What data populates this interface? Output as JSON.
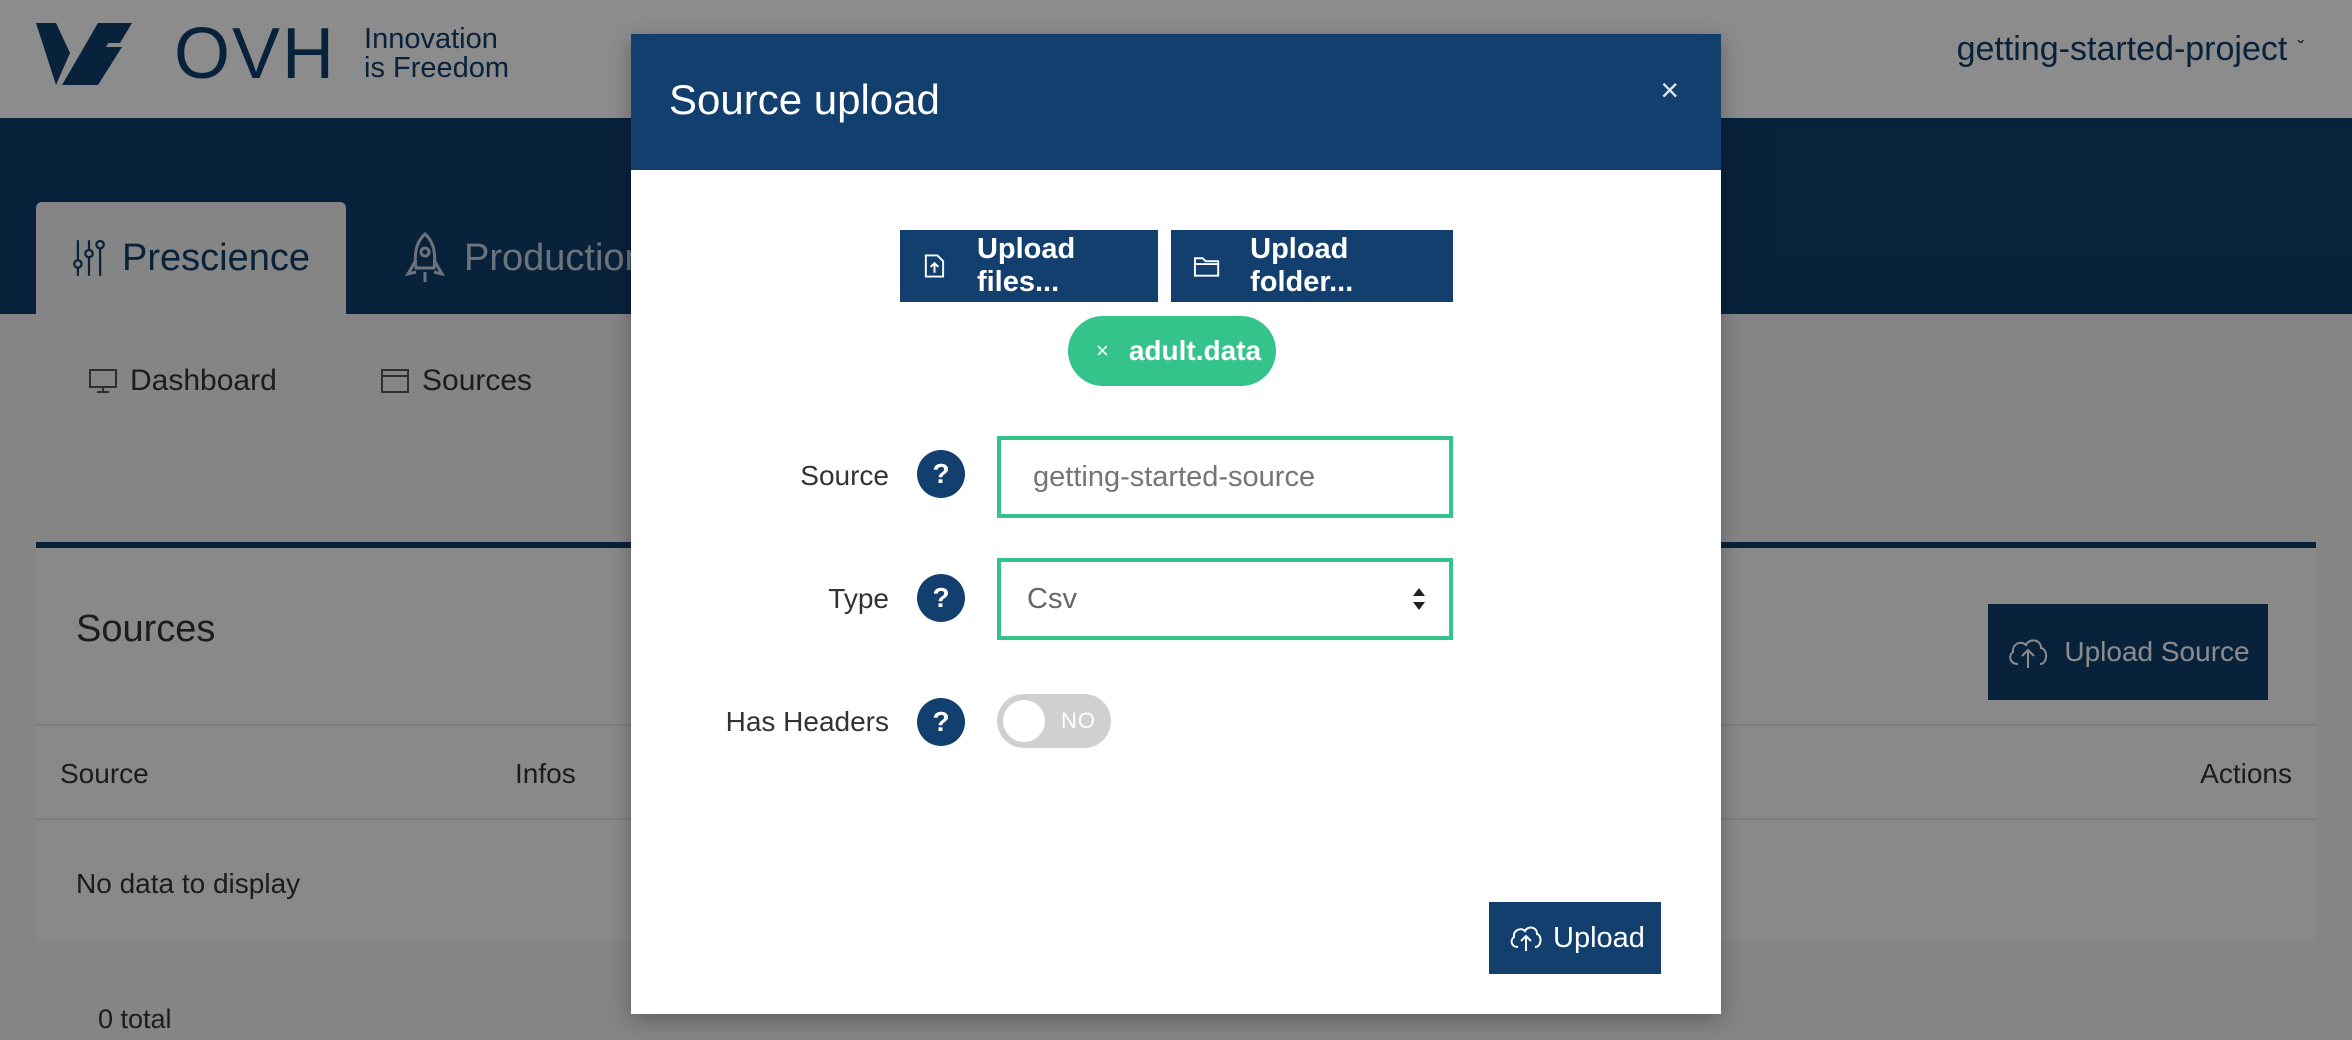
{
  "logo": {
    "brand": "OVH",
    "tagline_line1": "Innovation",
    "tagline_line2": "is Freedom"
  },
  "project_selector": {
    "label": "getting-started-project",
    "chevron": "ˇ"
  },
  "main_tabs": [
    {
      "label": "Prescience",
      "icon": "sliders-icon",
      "active": true
    },
    {
      "label": "Production",
      "icon": "rocket-icon",
      "active": false
    }
  ],
  "subnav": [
    {
      "label": "Dashboard",
      "icon": "monitor-icon"
    },
    {
      "label": "Sources",
      "icon": "window-icon"
    }
  ],
  "panel": {
    "title": "Sources",
    "upload_button": "Upload Source",
    "columns": [
      "Source",
      "Infos",
      "Actions"
    ],
    "empty_text": "No data to display",
    "total": "0 total"
  },
  "modal": {
    "title": "Source upload",
    "close": "×",
    "upload_files": "Upload files...",
    "upload_folder": "Upload folder...",
    "file_chip": {
      "remove": "×",
      "name": "adult.data"
    },
    "fields": {
      "source": {
        "label": "Source",
        "help": "?",
        "placeholder": "getting-started-source"
      },
      "type": {
        "label": "Type",
        "help": "?",
        "value": "Csv"
      },
      "has_headers": {
        "label": "Has Headers",
        "help": "?",
        "toggle_text": "NO",
        "on": false
      }
    },
    "upload_button": "Upload"
  },
  "colors": {
    "primary": "#123f6d",
    "accent": "#34c38a",
    "overlay": "rgba(0,0,0,0.45)"
  }
}
